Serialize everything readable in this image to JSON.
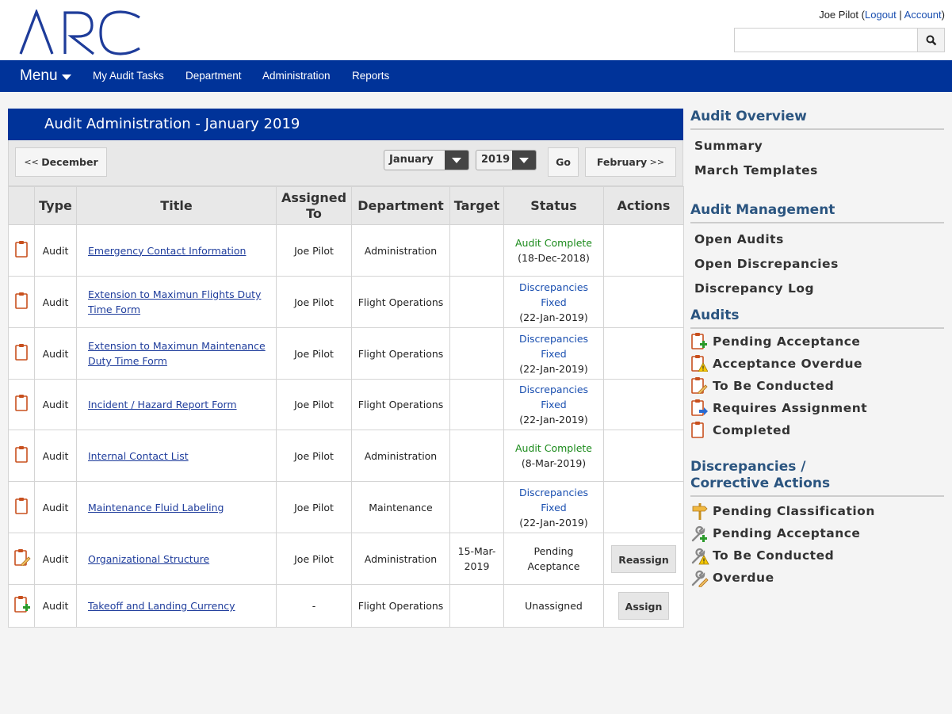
{
  "header": {
    "logo_text": "ARC",
    "user_name": "Joe Pilot",
    "logout_label": "Logout",
    "account_label": "Account",
    "search_value": ""
  },
  "nav": {
    "menu_label": "Menu",
    "links": [
      "My Audit Tasks",
      "Department",
      "Administration",
      "Reports"
    ]
  },
  "panel": {
    "title": "Audit Administration - January 2019",
    "prev_label": "December",
    "month_value": "January",
    "year_value": "2019",
    "go_label": "Go",
    "next_label": "February"
  },
  "table": {
    "headers": [
      "Type",
      "Title",
      "Assigned To",
      "Department",
      "Target",
      "Status",
      "Actions"
    ],
    "rows": [
      {
        "icon": "clipboard-icon",
        "type": "Audit",
        "title": "Emergency Contact Information",
        "assigned": "Joe Pilot",
        "department": "Administration",
        "target": "",
        "status": "Audit Complete",
        "status_date": "(18-Dec-2018)",
        "status_color": "green",
        "action": ""
      },
      {
        "icon": "clipboard-icon",
        "type": "Audit",
        "title": "Extension to Maximun Flights Duty Time Form",
        "assigned": "Joe Pilot",
        "department": "Flight Operations",
        "target": "",
        "status": "Discrepancies Fixed",
        "status_date": "(22-Jan-2019)",
        "status_color": "blue",
        "action": ""
      },
      {
        "icon": "clipboard-icon",
        "type": "Audit",
        "title": "Extension to Maximun Maintenance Duty Time Form",
        "assigned": "Joe Pilot",
        "department": "Flight Operations",
        "target": "",
        "status": "Discrepancies Fixed",
        "status_date": "(22-Jan-2019)",
        "status_color": "blue",
        "action": ""
      },
      {
        "icon": "clipboard-icon",
        "type": "Audit",
        "title": "Incident / Hazard Report Form",
        "assigned": "Joe Pilot",
        "department": "Flight Operations",
        "target": "",
        "status": "Discrepancies Fixed",
        "status_date": "(22-Jan-2019)",
        "status_color": "blue",
        "action": ""
      },
      {
        "icon": "clipboard-icon",
        "type": "Audit",
        "title": "Internal Contact List",
        "assigned": "Joe Pilot",
        "department": "Administration",
        "target": "",
        "status": "Audit Complete",
        "status_date": "(8-Mar-2019)",
        "status_color": "green",
        "action": ""
      },
      {
        "icon": "clipboard-icon",
        "type": "Audit",
        "title": "Maintenance Fluid Labeling",
        "assigned": "Joe Pilot",
        "department": "Maintenance",
        "target": "",
        "status": "Discrepancies Fixed",
        "status_date": "(22-Jan-2019)",
        "status_color": "blue",
        "action": ""
      },
      {
        "icon": "clipboard-pencil-icon",
        "type": "Audit",
        "title": "Organizational Structure",
        "assigned": "Joe Pilot",
        "department": "Administration",
        "target": "15-Mar-2019",
        "status": "Pending Aceptance",
        "status_date": "",
        "status_color": "dark",
        "action": "Reassign"
      },
      {
        "icon": "clipboard-plus-icon",
        "type": "Audit",
        "title": "Takeoff and Landing Currency",
        "assigned": "-",
        "department": "Flight Operations",
        "target": "",
        "status": "Unassigned",
        "status_date": "",
        "status_color": "dark",
        "action": "Assign"
      }
    ]
  },
  "sidebar": {
    "overview_heading": "Audit Overview",
    "overview_links": [
      "Summary",
      "March Templates"
    ],
    "management_heading": "Audit Management",
    "management_links": [
      "Open Audits",
      "Open Discrepancies",
      "Discrepancy Log"
    ],
    "audits_heading": "Audits",
    "audits_links": [
      {
        "label": "Pending Acceptance",
        "icon": "clipboard-plus-icon"
      },
      {
        "label": "Acceptance Overdue",
        "icon": "clipboard-warning-icon"
      },
      {
        "label": "To Be Conducted",
        "icon": "clipboard-pencil-icon"
      },
      {
        "label": "Requires Assignment",
        "icon": "clipboard-arrow-icon"
      },
      {
        "label": "Completed",
        "icon": "clipboard-icon"
      }
    ],
    "disc_heading_1": "Discrepancies /",
    "disc_heading_2": "Corrective Actions",
    "disc_links": [
      {
        "label": "Pending Classification",
        "icon": "signpost-icon"
      },
      {
        "label": "Pending Acceptance",
        "icon": "wrench-plus-icon"
      },
      {
        "label": "To Be Conducted",
        "icon": "wrench-warning-icon"
      },
      {
        "label": "Overdue",
        "icon": "wrench-pencil-icon"
      }
    ]
  },
  "colors": {
    "brand_blue": "#003399",
    "status_green": "#1a8a1a",
    "status_blue": "#1a4fb0",
    "icon_orange": "#c8501e"
  }
}
